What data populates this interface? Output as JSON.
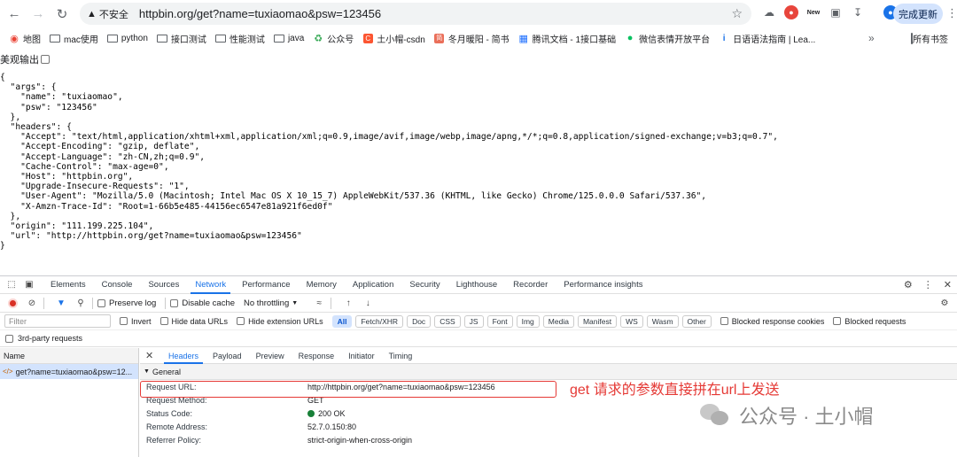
{
  "browser": {
    "insecure_label": "不安全",
    "url": "httpbin.org/get?name=tuxiaomao&psw=123456",
    "update_button": "完成更新",
    "ext_new_label": "New"
  },
  "bookmarks": {
    "items": [
      {
        "label": "地图",
        "icon": "map-icon"
      },
      {
        "label": "mac使用",
        "icon": "folder-icon"
      },
      {
        "label": "python",
        "icon": "folder-icon"
      },
      {
        "label": "接口测试",
        "icon": "folder-icon"
      },
      {
        "label": "性能测试",
        "icon": "folder-icon"
      },
      {
        "label": "java",
        "icon": "folder-icon"
      },
      {
        "label": "公众号",
        "icon": "recycle-icon"
      },
      {
        "label": "土小帽-csdn",
        "icon": "csdn-icon"
      },
      {
        "label": "冬月暖阳 - 简书",
        "icon": "jianshu-icon"
      },
      {
        "label": "腾讯文档 - 1接口基础",
        "icon": "tencent-docs-icon"
      },
      {
        "label": "微信表情开放平台",
        "icon": "wechat-icon"
      },
      {
        "label": "日语语法指南 | Lea...",
        "icon": "info-icon"
      }
    ],
    "all_bookmarks": "所有书签"
  },
  "page": {
    "pretty_print_label": "美观输出",
    "json_lines": [
      "{",
      "  \"args\": {",
      "    \"name\": \"tuxiaomao\",",
      "    \"psw\": \"123456\"",
      "  },",
      "  \"headers\": {",
      "    \"Accept\": \"text/html,application/xhtml+xml,application/xml;q=0.9,image/avif,image/webp,image/apng,*/*;q=0.8,application/signed-exchange;v=b3;q=0.7\",",
      "    \"Accept-Encoding\": \"gzip, deflate\",",
      "    \"Accept-Language\": \"zh-CN,zh;q=0.9\",",
      "    \"Cache-Control\": \"max-age=0\",",
      "    \"Host\": \"httpbin.org\",",
      "    \"Upgrade-Insecure-Requests\": \"1\",",
      "    \"User-Agent\": \"Mozilla/5.0 (Macintosh; Intel Mac OS X 10_15_7) AppleWebKit/537.36 (KHTML, like Gecko) Chrome/125.0.0.0 Safari/537.36\",",
      "    \"X-Amzn-Trace-Id\": \"Root=1-66b5e485-44156ec6547e81a921f6ed0f\"",
      "  },",
      "  \"origin\": \"111.199.225.104\",",
      "  \"url\": \"http://httpbin.org/get?name=tuxiaomao&psw=123456\"",
      "}"
    ]
  },
  "devtools": {
    "tabs": [
      "Elements",
      "Console",
      "Sources",
      "Network",
      "Performance",
      "Memory",
      "Application",
      "Security",
      "Lighthouse",
      "Recorder",
      "Performance insights"
    ],
    "active_tab": "Network",
    "toolbar": {
      "preserve_log": "Preserve log",
      "disable_cache": "Disable cache",
      "throttling": "No throttling"
    },
    "filter": {
      "placeholder": "Filter",
      "invert": "Invert",
      "hide_data_urls": "Hide data URLs",
      "hide_extension_urls": "Hide extension URLs",
      "types": [
        "All",
        "Fetch/XHR",
        "Doc",
        "CSS",
        "JS",
        "Font",
        "Img",
        "Media",
        "Manifest",
        "WS",
        "Wasm",
        "Other"
      ],
      "blocked_response_cookies": "Blocked response cookies",
      "blocked_requests": "Blocked requests",
      "third_party": "3rd-party requests"
    },
    "request_list": {
      "header": "Name",
      "rows": [
        "get?name=tuxiaomao&psw=12..."
      ]
    },
    "detail_tabs": [
      "Headers",
      "Payload",
      "Preview",
      "Response",
      "Initiator",
      "Timing"
    ],
    "general": {
      "title": "General",
      "rows": [
        {
          "key": "Request URL:",
          "value": "http://httpbin.org/get?name=tuxiaomao&psw=123456"
        },
        {
          "key": "Request Method:",
          "value": "GET"
        },
        {
          "key": "Status Code:",
          "value": "200 OK"
        },
        {
          "key": "Remote Address:",
          "value": "52.7.0.150:80"
        },
        {
          "key": "Referrer Policy:",
          "value": "strict-origin-when-cross-origin"
        }
      ]
    }
  },
  "annotation": "get 请求的参数直接拼在url上发送",
  "watermark": "公众号 · 土小帽",
  "colors": {
    "accent": "#1a73e8",
    "annotation": "#e53935",
    "status_ok": "#188038"
  }
}
